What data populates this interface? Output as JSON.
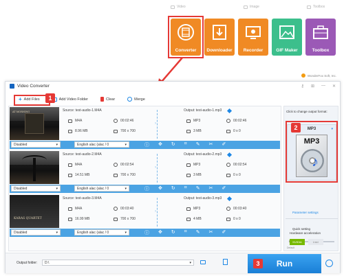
{
  "launcher": {
    "categories": {
      "video": "Video",
      "image": "Image",
      "toolbox": "Toolbox"
    },
    "tools": [
      {
        "label": "Converter",
        "color": "#f08a24"
      },
      {
        "label": "Downloader",
        "color": "#f08a24"
      },
      {
        "label": "Recorder",
        "color": "#f08a24"
      },
      {
        "label": "GIF Maker",
        "color": "#3cbf8c"
      },
      {
        "label": "Toolbox",
        "color": "#9b59b6"
      }
    ],
    "brand": "WonderFox Soft, Inc."
  },
  "window": {
    "title": "Video Converter"
  },
  "toolbar": {
    "add_files": "Add Files",
    "add_folder": "Add Video Folder",
    "clear": "Clear",
    "merge": "Merge"
  },
  "files": [
    {
      "source": "Source: test-audio-1.M4A",
      "output": "Output: test-audio-1.mp3",
      "src_format": "M4A",
      "src_duration": "00:02:46",
      "src_size": "8.96 MB",
      "src_res": "700 x 700",
      "out_format": "MP3",
      "out_duration": "00:02:46",
      "out_size": "3 MB",
      "out_res": "0 x 0",
      "subtitle": "Disabled",
      "audio_track": "English alac (alac / 0"
    },
    {
      "source": "Source: test-audio-2.M4A",
      "output": "Output: test-audio-2.mp3",
      "src_format": "M4A",
      "src_duration": "00:02:54",
      "src_size": "14.51 MB",
      "src_res": "700 x 700",
      "out_format": "MP3",
      "out_duration": "00:02:54",
      "out_size": "3 MB",
      "out_res": "0 x 0",
      "subtitle": "Disabled",
      "audio_track": "English alac (alac / 0"
    },
    {
      "source": "Source: test-audio-3.M4A",
      "output": "Output: test-audio-3.mp3",
      "src_format": "M4A",
      "src_duration": "00:03:40",
      "src_size": "16.99 MB",
      "src_res": "700 x 700",
      "out_format": "MP3",
      "out_duration": "00:03:40",
      "out_size": "4 MB",
      "out_res": "0 x 0",
      "subtitle": "Disabled",
      "audio_track": "English alac (alac / 0"
    }
  ],
  "thumb_text": {
    "line1": "AT MORNING",
    "line3": "KARAS QUARTET"
  },
  "right_panel": {
    "header": "Click to change output format:",
    "format": "MP3",
    "format_icon_text": "MP3",
    "parameter_settings": "Parameter settings",
    "quick_setting": "Quick setting",
    "default_label": "Default",
    "hardware_acceleration": "Hardware acceleration",
    "nvidia": "NVIDIA",
    "intel": "Intel"
  },
  "bottom": {
    "output_folder_label": "Output folder:",
    "output_folder_value": "D:\\",
    "run": "Run"
  },
  "badges": [
    "1",
    "2",
    "3"
  ]
}
